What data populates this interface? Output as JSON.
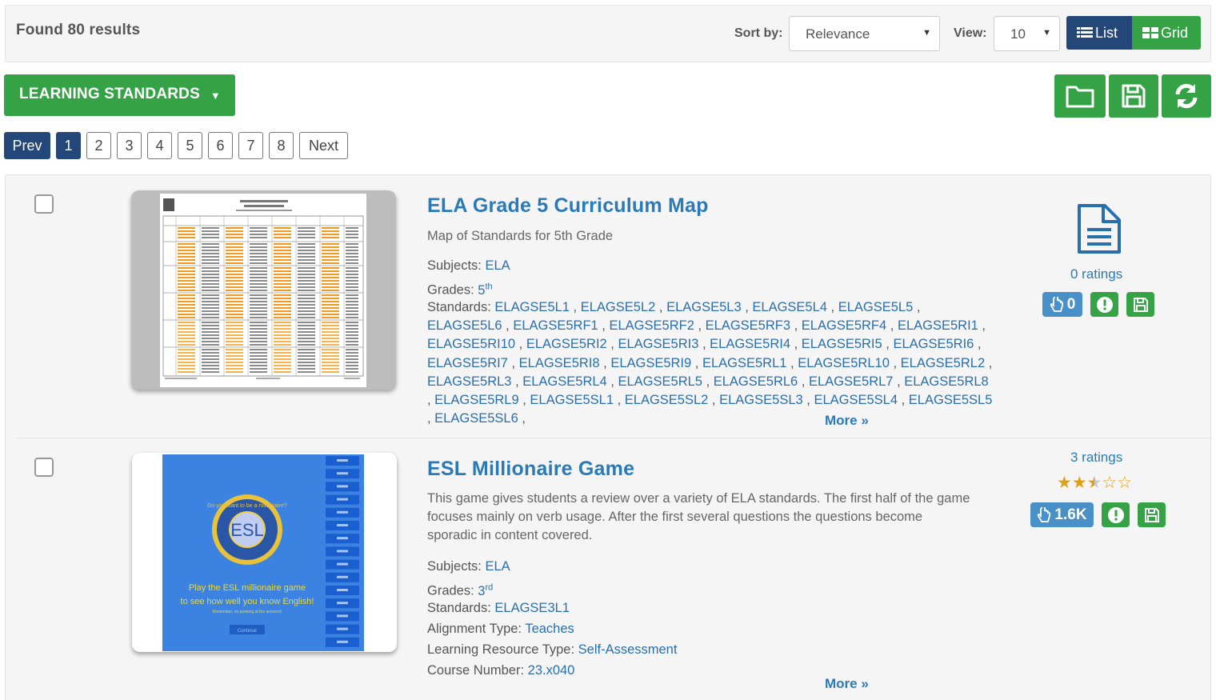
{
  "header": {
    "found_text": "Found 80 results",
    "sort_label": "Sort by:",
    "sort_value": "Relevance",
    "view_label": "View:",
    "view_value": "10",
    "list_label": "List",
    "grid_label": "Grid"
  },
  "toolbar": {
    "standards_label": "LEARNING STANDARDS",
    "icons": [
      "folder-icon",
      "save-icon",
      "refresh-icon"
    ]
  },
  "pagination": {
    "prev": "Prev",
    "pages": [
      "1",
      "2",
      "3",
      "4",
      "5",
      "6",
      "7",
      "8"
    ],
    "active_page": "1",
    "next": "Next"
  },
  "results": [
    {
      "title": "ELA Grade 5 Curriculum Map",
      "description": "Map of Standards for 5th Grade",
      "subjects_label": "Subjects:",
      "subjects": "ELA",
      "grades_label": "Grades:",
      "grade": "5",
      "grade_suffix": "th",
      "standards_label": "Standards:",
      "standards": [
        "ELAGSE5L1",
        "ELAGSE5L2",
        "ELAGSE5L3",
        "ELAGSE5L4",
        "ELAGSE5L5",
        "ELAGSE5L6",
        "ELAGSE5RF1",
        "ELAGSE5RF2",
        "ELAGSE5RF3",
        "ELAGSE5RF4",
        "ELAGSE5RI1",
        "ELAGSE5RI10",
        "ELAGSE5RI2",
        "ELAGSE5RI3",
        "ELAGSE5RI4",
        "ELAGSE5RI5",
        "ELAGSE5RI6",
        "ELAGSE5RI7",
        "ELAGSE5RI8",
        "ELAGSE5RI9",
        "ELAGSE5RL1",
        "ELAGSE5RL10",
        "ELAGSE5RL2",
        "ELAGSE5RL3",
        "ELAGSE5RL4",
        "ELAGSE5RL5",
        "ELAGSE5RL6",
        "ELAGSE5RL7",
        "ELAGSE5RL8",
        "ELAGSE5RL9",
        "ELAGSE5SL1",
        "ELAGSE5SL2",
        "ELAGSE5SL3",
        "ELAGSE5SL4",
        "ELAGSE5SL5",
        "ELAGSE5SL6"
      ],
      "more_label": "More »",
      "ratings_text": "0 ratings",
      "likes": "0",
      "type_icon": "document-icon"
    },
    {
      "title": "ESL Millionaire Game",
      "description": "This game gives students a review over a variety of ELA standards. The first half of the game focuses mainly on verb usage. After the first several questions the questions become sporadic in content covered.",
      "subjects_label": "Subjects:",
      "subjects": "ELA",
      "grades_label": "Grades:",
      "grade": "3",
      "grade_suffix": "rd",
      "standards_label": "Standards:",
      "standards_value": "ELAGSE3L1",
      "alignment_label": "Alignment Type:",
      "alignment": "Teaches",
      "resource_type_label": "Learning Resource Type:",
      "resource_type": "Self-Assessment",
      "course_label": "Course Number:",
      "course_number": "23.x040",
      "more_label": "More »",
      "ratings_text": "3 ratings",
      "rating_stars": 2.5,
      "likes": "1.6K",
      "thumb": {
        "circle_text": "ESL",
        "ring_text": "Do you want to be a millionaire?",
        "caption_1": "Play the ESL millionaire game",
        "caption_2": "to see how well you know English!",
        "caption_3": "Remember, no peeking at the answers!",
        "button": "Continue"
      }
    }
  ],
  "colors": {
    "navy": "#24477a",
    "green": "#35a246",
    "link": "#2a7ab8",
    "like_blue": "#4a90c8",
    "star": "#e0a012"
  }
}
